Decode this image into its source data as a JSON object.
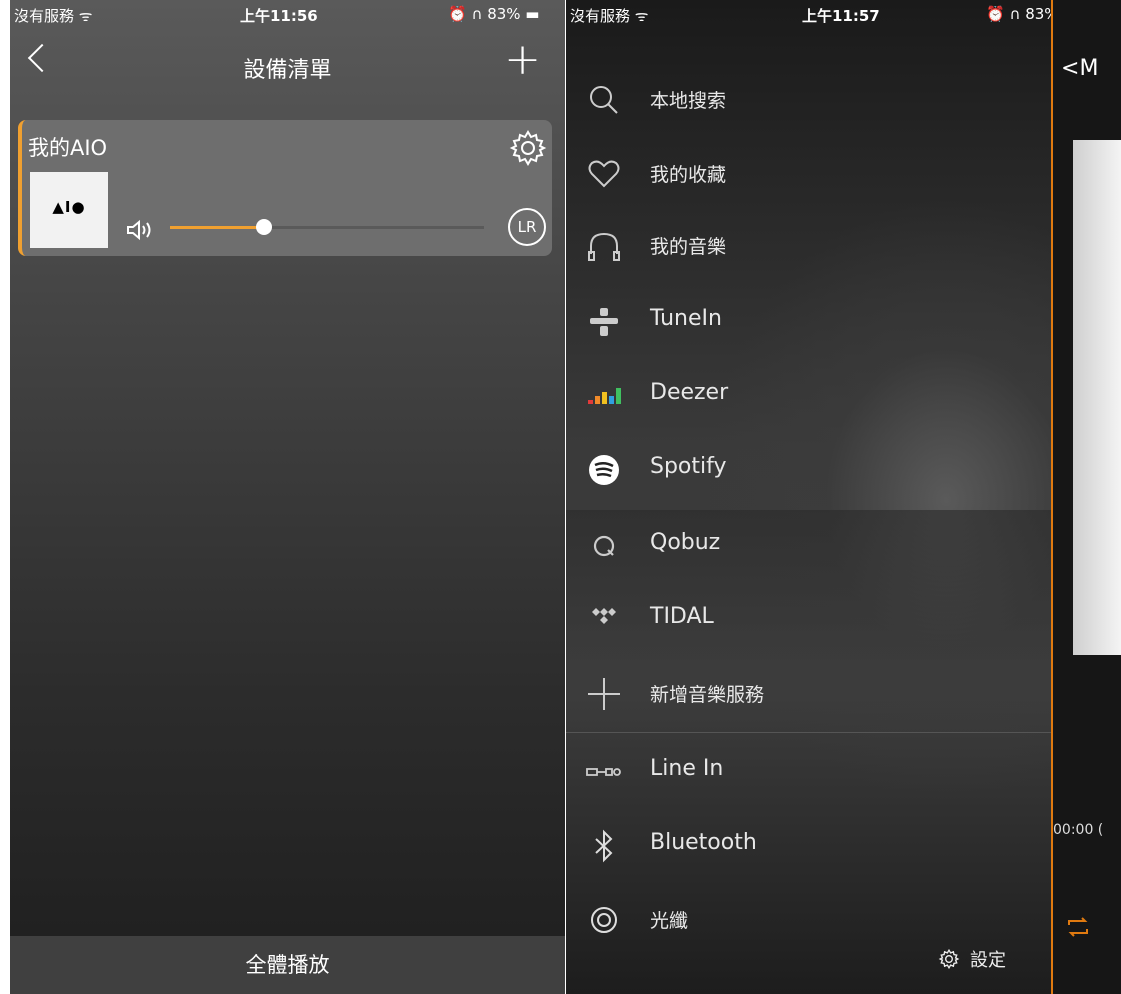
{
  "left": {
    "status": {
      "carrier": "沒有服務 ᯤ",
      "time": "上午11:56",
      "right": "⏰ ∩ 83% ▬"
    },
    "nav": {
      "title": "設備清單",
      "plus": "+"
    },
    "device": {
      "name": "我的AIO",
      "art_logo": "▲I●",
      "volume_level": 0.3,
      "channel": "LR"
    },
    "bottom_button": "全體播放"
  },
  "right": {
    "status": {
      "carrier": "沒有服務 ᯤ",
      "time": "上午11:57",
      "right": "⏰ ∩ 83% ▬"
    },
    "menu": [
      {
        "label": "本地搜索",
        "icon": "search-icon"
      },
      {
        "label": "我的收藏",
        "icon": "heart-icon"
      },
      {
        "label": "我的音樂",
        "icon": "headphones-icon"
      },
      {
        "label": "TuneIn",
        "icon": "tunein-icon"
      },
      {
        "label": "Deezer",
        "icon": "deezer-icon"
      },
      {
        "label": "Spotify",
        "icon": "spotify-icon"
      },
      {
        "label": "Qobuz",
        "icon": "qobuz-icon"
      },
      {
        "label": "TIDAL",
        "icon": "tidal-icon"
      },
      {
        "label": "新增音樂服務",
        "icon": "add-icon"
      },
      {
        "label": "Line In",
        "icon": "line-in-icon"
      },
      {
        "label": "Bluetooth",
        "icon": "bluetooth-icon"
      },
      {
        "label": "光纖",
        "icon": "optical-icon"
      }
    ],
    "settings_label": "設定",
    "peek": {
      "back": "M",
      "timecode": "00:00 ("
    }
  },
  "colors": {
    "accent": "#f0a030"
  }
}
